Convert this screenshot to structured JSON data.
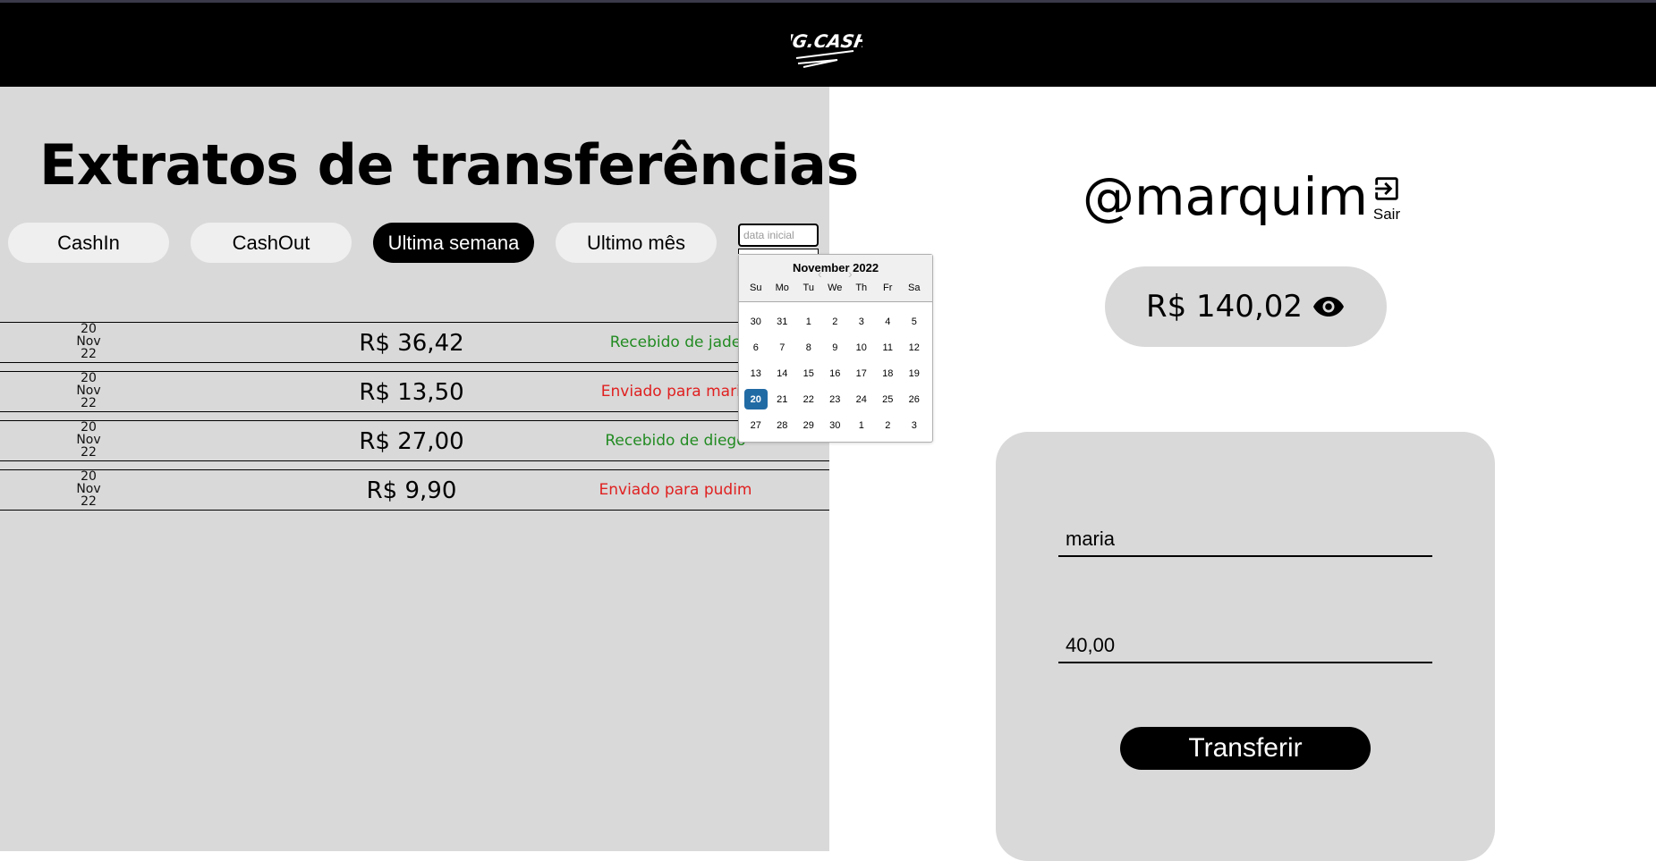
{
  "header": {
    "logo_text": "NG.CASH"
  },
  "left": {
    "title": "Extratos de transferências",
    "filters": [
      "CashIn",
      "CashOut",
      "Ultima semana",
      "Ultimo mês"
    ],
    "active_filter": "Ultima semana",
    "date_input": {
      "placeholder": "data inicial",
      "value": ""
    },
    "transactions": [
      {
        "day": "20",
        "month": "Nov",
        "year": "22",
        "amount": "R$ 36,42",
        "description": "Recebido de jade",
        "type": "received"
      },
      {
        "day": "20",
        "month": "Nov",
        "year": "22",
        "amount": "R$ 13,50",
        "description": "Enviado para maria",
        "type": "sent"
      },
      {
        "day": "20",
        "month": "Nov",
        "year": "22",
        "amount": "R$ 27,00",
        "description": "Recebido de diego",
        "type": "received"
      },
      {
        "day": "20",
        "month": "Nov",
        "year": "22",
        "amount": "R$ 9,90",
        "description": "Enviado para pudim",
        "type": "sent"
      }
    ]
  },
  "calendar": {
    "month_label": "November 2022",
    "weekdays": [
      "Su",
      "Mo",
      "Tu",
      "We",
      "Th",
      "Fr",
      "Sa"
    ],
    "weeks": [
      [
        "30",
        "31",
        "1",
        "2",
        "3",
        "4",
        "5"
      ],
      [
        "6",
        "7",
        "8",
        "9",
        "10",
        "11",
        "12"
      ],
      [
        "13",
        "14",
        "15",
        "16",
        "17",
        "18",
        "19"
      ],
      [
        "20",
        "21",
        "22",
        "23",
        "24",
        "25",
        "26"
      ],
      [
        "27",
        "28",
        "29",
        "30",
        "1",
        "2",
        "3"
      ]
    ],
    "selected_day": "20",
    "selected_color": "#216ba5"
  },
  "right": {
    "username": "@marquim",
    "logout_label": "Sair",
    "balance": "R$ 140,02",
    "transfer_form": {
      "recipient_value": "maria",
      "amount_value": "40,00",
      "submit_label": "Transferir"
    }
  },
  "colors": {
    "received": "#228b22",
    "sent": "#e02020",
    "panel_gray": "#d9d9d9",
    "header_black": "#000000"
  },
  "icons": {
    "logout": "logout-icon",
    "balance_toggle": "eye-icon"
  }
}
